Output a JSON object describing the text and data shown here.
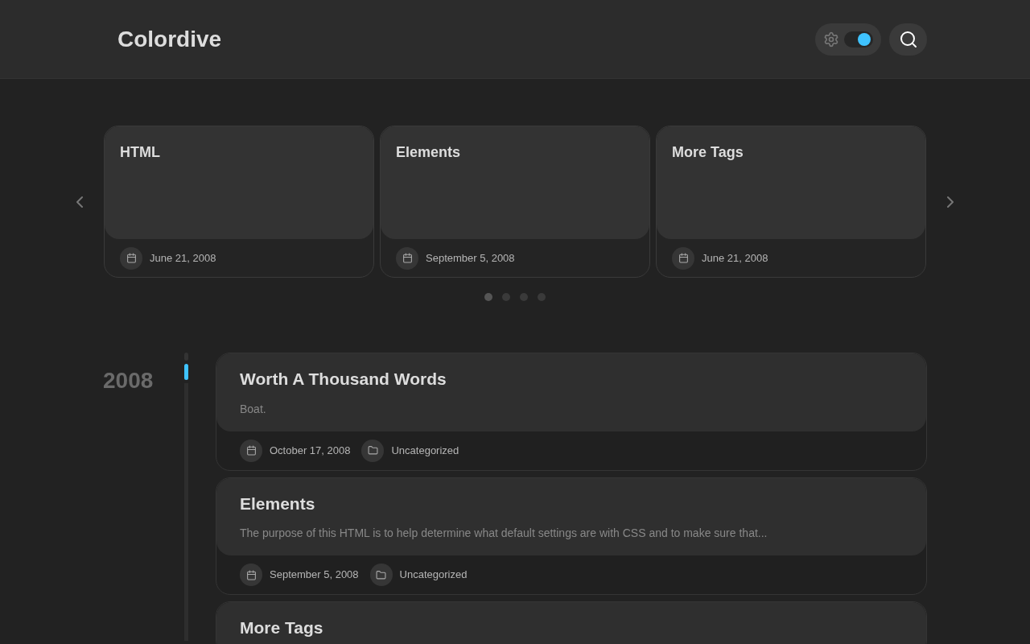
{
  "header": {
    "logo": "Colordive",
    "theme_toggle": {
      "on": true
    }
  },
  "carousel": {
    "cards": [
      {
        "title": "HTML",
        "date": "June 21, 2008"
      },
      {
        "title": "Elements",
        "date": "September 5, 2008"
      },
      {
        "title": "More Tags",
        "date": "June 21, 2008"
      }
    ],
    "dots": [
      {
        "selected": true
      },
      {
        "selected": false
      },
      {
        "selected": false
      },
      {
        "selected": false
      }
    ]
  },
  "timeline": {
    "year": "2008",
    "posts": [
      {
        "title": "Worth A Thousand Words",
        "excerpt": "Boat.",
        "date": "October 17, 2008",
        "category": "Uncategorized"
      },
      {
        "title": "Elements",
        "excerpt": "The purpose of this HTML is to help determine what default settings are with CSS and to make sure that...",
        "date": "September 5, 2008",
        "category": "Uncategorized"
      },
      {
        "title": "More Tags"
      }
    ]
  }
}
